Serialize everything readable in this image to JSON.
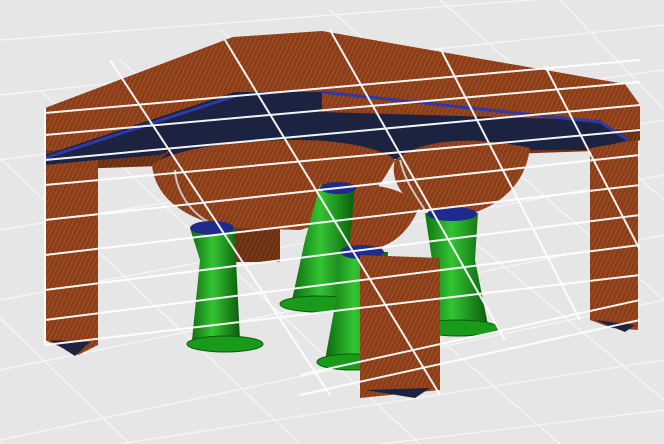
{
  "viewport": {
    "background": "#e6e6e6",
    "build_plate_grid_color": "#f7f7f7"
  },
  "colors": {
    "model_wall": "#8b3d17",
    "model_wall_dark": "#5e2a10",
    "model_infill_line": "#c87a4a",
    "support": "#1e9a1e",
    "support_dark": "#0d5f0d",
    "support_line": "#55d455",
    "bridge_skin": "#1c2340",
    "bridge_edge": "#2d3aa8",
    "overlay_grid": "#ffffff"
  },
  "layers": [
    {
      "name": "walls",
      "visible": true
    },
    {
      "name": "bridges",
      "visible": true
    },
    {
      "name": "supports",
      "visible": true
    },
    {
      "name": "overlay-grid",
      "visible": true
    }
  ]
}
